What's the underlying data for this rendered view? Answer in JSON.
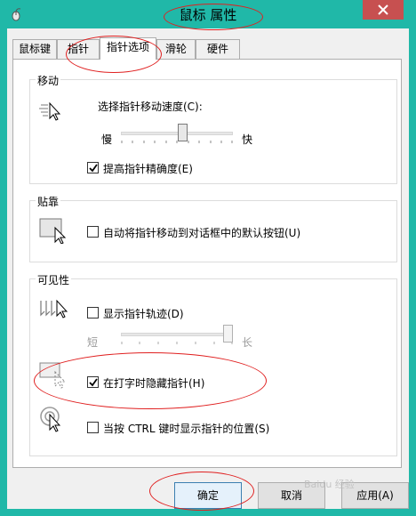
{
  "window": {
    "title": "鼠标 属性"
  },
  "tabs": [
    {
      "label": "鼠标键"
    },
    {
      "label": "指针"
    },
    {
      "label": "指针选项",
      "active": true
    },
    {
      "label": "滑轮"
    },
    {
      "label": "硬件"
    }
  ],
  "motion": {
    "label": "移动",
    "speed_label": "选择指针移动速度(C):",
    "slow": "慢",
    "fast": "快",
    "speed_value_fraction": 0.55,
    "precision": {
      "label": "提高指针精确度(E)",
      "checked": true
    }
  },
  "snap": {
    "label": "贴靠",
    "snap_to_default": {
      "label": "自动将指针移动到对话框中的默认按钮(U)",
      "checked": false
    }
  },
  "visibility": {
    "label": "可见性",
    "trails": {
      "label": "显示指针轨迹(D)",
      "checked": false
    },
    "short": "短",
    "long": "长",
    "trail_length_fraction": 1.0,
    "hide_while_typing": {
      "label": "在打字时隐藏指针(H)",
      "checked": true
    },
    "show_location_ctrl": {
      "label": "当按 CTRL 键时显示指针的位置(S)",
      "checked": false
    }
  },
  "buttons": {
    "ok": "确定",
    "cancel": "取消",
    "apply": "应用(A)"
  },
  "watermark": "Baidu 经验",
  "colors": {
    "titlebar": "#20b8a8",
    "close": "#c75050",
    "annotation": "#e02020",
    "check": "#000000"
  }
}
